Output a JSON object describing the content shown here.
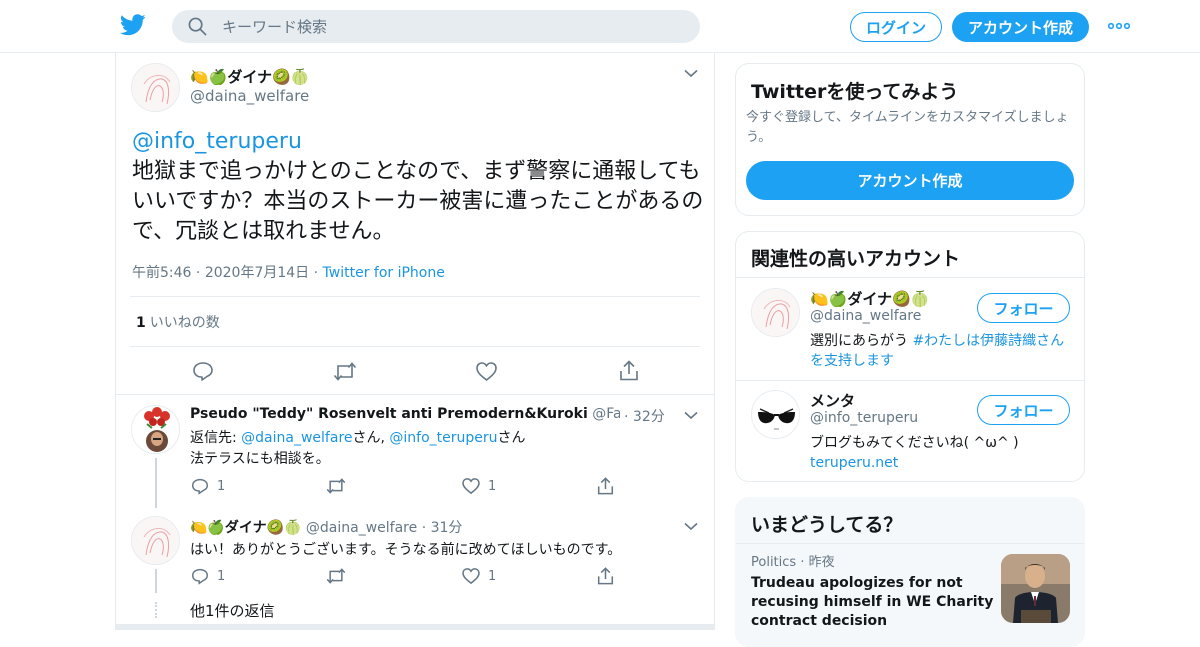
{
  "header": {
    "search_placeholder": "キーワード検索",
    "login_label": "ログイン",
    "signup_label": "アカウント作成",
    "more_icon": "more-dots-icon"
  },
  "main_tweet": {
    "display_name": "🍋🍏ダイナ🥝🍈",
    "handle": "@daina_welfare",
    "mention": "@info_teruperu",
    "text": "地獄まで追っかけとのことなので、まず警察に通報してもいいですか？本当のストーカー被害に遭ったことがあるので、冗談とは取れません。",
    "time": "午前5:46",
    "date": "2020年7月14日",
    "source": "Twitter for iPhone",
    "like_count": "1",
    "like_label": "いいねの数"
  },
  "replies": [
    {
      "display_name": "Pseudo \"Teddy\" Rosenvelt anti Premodern&Kuroki",
      "handle": "@FakeRos...",
      "time": "32分",
      "reply_to_prefix": "返信先: ",
      "reply_to_1": "@daina_welfare",
      "reply_to_sep": "さん, ",
      "reply_to_2": "@info_teruperu",
      "reply_to_suffix": "さん",
      "text": "法テラスにも相談を。",
      "reply_count": "1",
      "like_count": "1"
    },
    {
      "display_name": "🍋🍏ダイナ🥝🍈",
      "handle": "@daina_welfare",
      "time": "31分",
      "text": "はい！ありがとうございます。そうなる前に改めてほしいものです。",
      "reply_count": "1",
      "like_count": "1"
    }
  ],
  "more_replies_label": "他1件の返信",
  "sidebar": {
    "signup_card": {
      "title": "Twitterを使ってみよう",
      "desc": "今すぐ登録して、タイムラインをカスタマイズしましょう。",
      "button": "アカウント作成"
    },
    "related_card": {
      "title": "関連性の高いアカウント",
      "follow_label": "フォロー",
      "accounts": [
        {
          "display_name": "🍋🍏ダイナ🥝🍈",
          "handle": "@daina_welfare",
          "bio_prefix": "選別にあらがう ",
          "bio_link": "#わたしは伊藤詩織さんを支持します"
        },
        {
          "display_name": "メンタ",
          "handle": "@info_teruperu",
          "bio": "ブログもみてくださいね( ^ω^ )",
          "bio_link": "teruperu.net"
        }
      ]
    },
    "trends_card": {
      "title": "いまどうしてる？",
      "category": "Politics",
      "when": "昨夜",
      "headline": "Trudeau apologizes for not recusing himself in WE Charity contract decision"
    }
  }
}
